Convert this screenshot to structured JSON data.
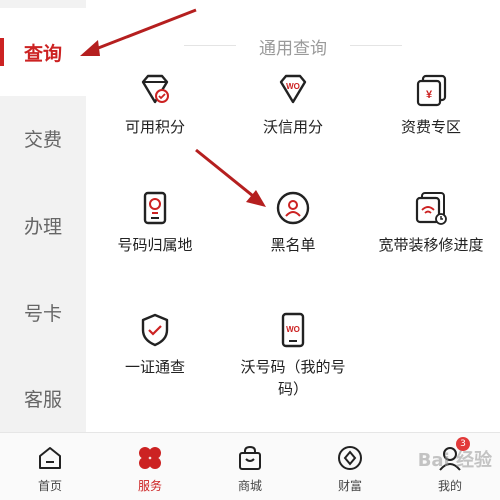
{
  "colors": {
    "accent": "#cc2222",
    "sidebar_bg": "#f2f2f2",
    "text": "#222222"
  },
  "sidebar": {
    "items": [
      {
        "label": "查询",
        "active": true
      },
      {
        "label": "交费"
      },
      {
        "label": "办理"
      },
      {
        "label": "号卡"
      },
      {
        "label": "客服"
      }
    ]
  },
  "main": {
    "section_title": "通用查询",
    "items": [
      {
        "label": "可用积分",
        "icon": "diamond-points-icon"
      },
      {
        "label": "沃信用分",
        "icon": "wo-credit-icon"
      },
      {
        "label": "资费专区",
        "icon": "tariff-cards-icon"
      },
      {
        "label": "号码归属地",
        "icon": "phone-location-icon"
      },
      {
        "label": "黑名单",
        "icon": "blacklist-user-icon"
      },
      {
        "label": "宽带装移修进度",
        "icon": "broadband-progress-icon"
      },
      {
        "label": "一证通查",
        "icon": "id-shield-check-icon"
      },
      {
        "label": "沃号码（我的号码）",
        "icon": "wo-phone-icon"
      }
    ]
  },
  "bottom_nav": {
    "items": [
      {
        "label": "首页",
        "icon": "home-icon"
      },
      {
        "label": "服务",
        "icon": "service-clover-icon",
        "active": true
      },
      {
        "label": "商城",
        "icon": "shopping-bag-icon"
      },
      {
        "label": "财富",
        "icon": "wealth-coin-icon"
      },
      {
        "label": "我的",
        "icon": "profile-icon",
        "badge": "3"
      }
    ]
  },
  "watermark": "Bai 经验"
}
